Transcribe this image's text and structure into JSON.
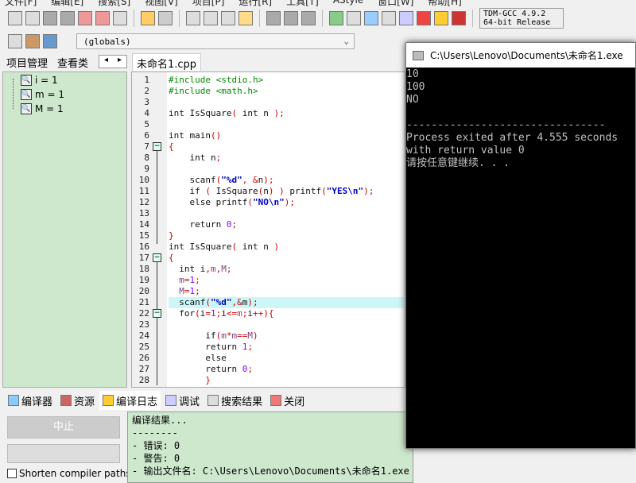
{
  "menu": [
    "文件[F]",
    "编辑[E]",
    "搜索[S]",
    "视图[V]",
    "项目[P]",
    "运行[R]",
    "工具[T]",
    "AStyle",
    "窗口[W]",
    "帮助[H]"
  ],
  "toolbar": {
    "compiler": "TDM-GCC 4.9.2 64-bit Release",
    "scope": "(globals)"
  },
  "left_tabs": [
    "项目管理",
    "查看类"
  ],
  "watch": [
    "i = 1",
    "m = 1",
    "M = 1"
  ],
  "editor": {
    "tab": "未命名1.cpp",
    "highlight_line": 21,
    "lines": [
      [
        [
          "#include <stdio.h>",
          "d"
        ]
      ],
      [
        [
          "#include <math.h>",
          "d"
        ]
      ],
      [],
      [
        [
          "int IsSquare",
          "k"
        ],
        [
          "( ",
          "p"
        ],
        [
          "int n ",
          "k"
        ],
        [
          ");",
          "p"
        ]
      ],
      [],
      [
        [
          "int main",
          "k"
        ],
        [
          "()",
          "p"
        ]
      ],
      [
        [
          "{",
          "p"
        ]
      ],
      [
        [
          "    int n",
          "k"
        ],
        [
          ";",
          "p"
        ]
      ],
      [],
      [
        [
          "    scanf",
          "k"
        ],
        [
          "(",
          "p"
        ],
        [
          "\"%d\"",
          "s"
        ],
        [
          ", &",
          "p"
        ],
        [
          "n",
          "k"
        ],
        [
          ");",
          "p"
        ]
      ],
      [
        [
          "    if ",
          "k"
        ],
        [
          "( ",
          "p"
        ],
        [
          "IsSquare",
          "k"
        ],
        [
          "(",
          "p"
        ],
        [
          "n",
          "k"
        ],
        [
          ") ) ",
          "p"
        ],
        [
          "printf",
          "k"
        ],
        [
          "(",
          "p"
        ],
        [
          "\"YES\\n\"",
          "s"
        ],
        [
          ");",
          "p"
        ]
      ],
      [
        [
          "    else printf",
          "k"
        ],
        [
          "(",
          "p"
        ],
        [
          "\"NO\\n\"",
          "s"
        ],
        [
          ");",
          "p"
        ]
      ],
      [],
      [
        [
          "    return ",
          "k"
        ],
        [
          "0",
          "n"
        ],
        [
          ";",
          "p"
        ]
      ],
      [
        [
          "}",
          "p"
        ]
      ],
      [
        [
          "int IsSquare",
          "k"
        ],
        [
          "( ",
          "p"
        ],
        [
          "int n ",
          "k"
        ],
        [
          ")",
          "p"
        ]
      ],
      [
        [
          "{",
          "p"
        ]
      ],
      [
        [
          "  int i",
          "k"
        ],
        [
          ",",
          "p"
        ],
        [
          "m",
          "v"
        ],
        [
          ",",
          "p"
        ],
        [
          "M",
          "v"
        ],
        [
          ";",
          "p"
        ]
      ],
      [
        [
          "  m",
          "v"
        ],
        [
          "=",
          "p"
        ],
        [
          "1",
          "n"
        ],
        [
          ";",
          "p"
        ]
      ],
      [
        [
          "  M",
          "v"
        ],
        [
          "=",
          "p"
        ],
        [
          "1",
          "n"
        ],
        [
          ";",
          "p"
        ]
      ],
      [
        [
          "  scanf",
          "k"
        ],
        [
          "(",
          "p"
        ],
        [
          "\"%d\"",
          "s"
        ],
        [
          ",&",
          "p"
        ],
        [
          "m",
          "k"
        ],
        [
          ");",
          "p"
        ]
      ],
      [
        [
          "  for",
          "k"
        ],
        [
          "(",
          "p"
        ],
        [
          "i",
          "k"
        ],
        [
          "=",
          "p"
        ],
        [
          "1",
          "n"
        ],
        [
          ";",
          "p"
        ],
        [
          "i",
          "k"
        ],
        [
          "<=",
          "p"
        ],
        [
          "m",
          "v"
        ],
        [
          ";",
          "p"
        ],
        [
          "i",
          "k"
        ],
        [
          "++){",
          "p"
        ]
      ],
      [],
      [
        [
          "       if",
          "k"
        ],
        [
          "(",
          "p"
        ],
        [
          "m",
          "v"
        ],
        [
          "*",
          "p"
        ],
        [
          "m",
          "v"
        ],
        [
          "==",
          "p"
        ],
        [
          "M",
          "v"
        ],
        [
          ")",
          "p"
        ]
      ],
      [
        [
          "       return ",
          "k"
        ],
        [
          "1",
          "n"
        ],
        [
          ";",
          "p"
        ]
      ],
      [
        [
          "       else",
          "k"
        ]
      ],
      [
        [
          "       return ",
          "k"
        ],
        [
          "0",
          "n"
        ],
        [
          ";",
          "p"
        ]
      ],
      [
        [
          "       }",
          "p"
        ]
      ]
    ]
  },
  "bottom_tabs": [
    "编译器",
    "资源",
    "编译日志",
    "调试",
    "搜索结果",
    "关闭"
  ],
  "bottom_active": 2,
  "abort_label": "中止",
  "shorten_label": "Shorten compiler paths",
  "log": [
    "编译结果...",
    "--------",
    "- 错误: 0",
    "- 警告: 0",
    "- 输出文件名: C:\\Users\\Lenovo\\Documents\\未命名1.exe"
  ],
  "console": {
    "title": "C:\\Users\\Lenovo\\Documents\\未命名1.exe",
    "lines": [
      "10",
      "100",
      "NO",
      "",
      "--------------------------------",
      "Process exited after 4.555 seconds with return value 0",
      "请按任意键继续. . ."
    ]
  }
}
